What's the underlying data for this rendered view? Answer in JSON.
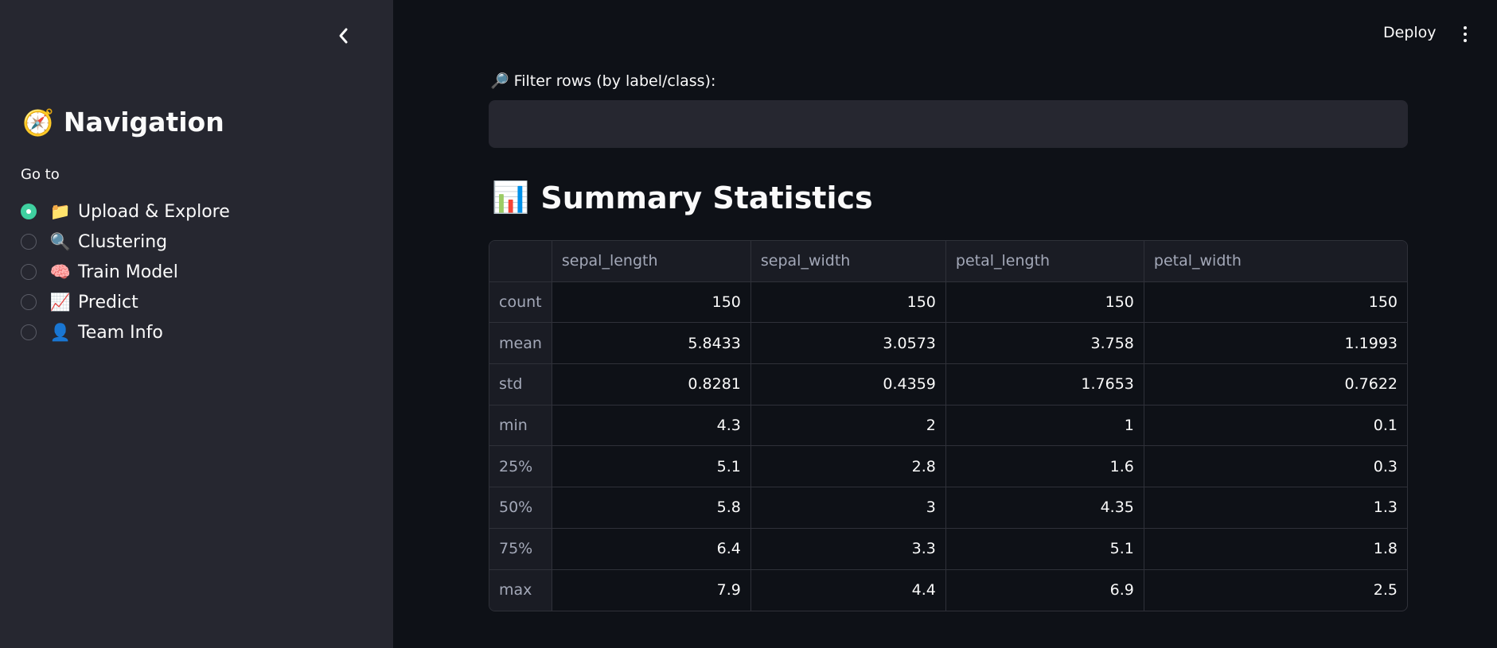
{
  "sidebar": {
    "title": "Navigation",
    "title_emoji": "🧭",
    "goto_label": "Go to",
    "items": [
      {
        "emoji": "📁",
        "label": "Upload & Explore"
      },
      {
        "emoji": "🔍",
        "label": "Clustering"
      },
      {
        "emoji": "🧠",
        "label": "Train Model"
      },
      {
        "emoji": "📈",
        "label": "Predict"
      },
      {
        "emoji": "👤",
        "label": "Team Info"
      }
    ],
    "selected_index": 0
  },
  "header": {
    "deploy_label": "Deploy"
  },
  "main": {
    "filter_label": "Filter rows (by label/class):",
    "filter_emoji": "🔎",
    "filter_value": "",
    "section_title": "Summary Statistics",
    "section_emoji": "📊"
  },
  "table": {
    "columns": [
      "",
      "sepal_length",
      "sepal_width",
      "petal_length",
      "petal_width"
    ],
    "rows": [
      {
        "label": "count",
        "values": [
          "150",
          "150",
          "150",
          "150"
        ]
      },
      {
        "label": "mean",
        "values": [
          "5.8433",
          "3.0573",
          "3.758",
          "1.1993"
        ]
      },
      {
        "label": "std",
        "values": [
          "0.8281",
          "0.4359",
          "1.7653",
          "0.7622"
        ]
      },
      {
        "label": "min",
        "values": [
          "4.3",
          "2",
          "1",
          "0.1"
        ]
      },
      {
        "label": "25%",
        "values": [
          "5.1",
          "2.8",
          "1.6",
          "0.3"
        ]
      },
      {
        "label": "50%",
        "values": [
          "5.8",
          "3",
          "4.35",
          "1.3"
        ]
      },
      {
        "label": "75%",
        "values": [
          "6.4",
          "3.3",
          "5.1",
          "1.8"
        ]
      },
      {
        "label": "max",
        "values": [
          "7.9",
          "4.4",
          "6.9",
          "2.5"
        ]
      }
    ]
  },
  "colors": {
    "sidebar_bg": "#262730",
    "main_bg": "#0e1117",
    "accent": "#3fd0a0"
  },
  "icons": {
    "collapse": "chevron-left-icon",
    "menu": "kebab-menu-icon"
  }
}
